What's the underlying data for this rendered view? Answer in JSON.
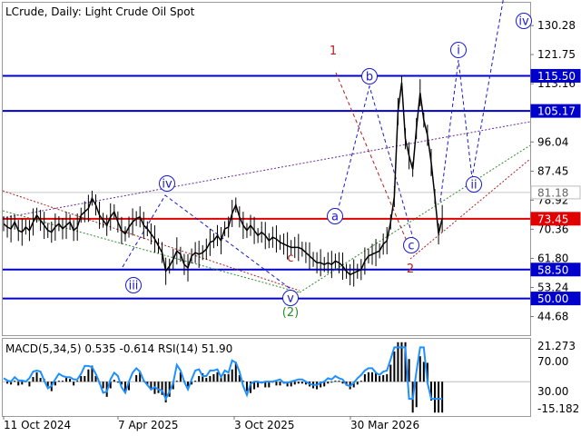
{
  "header": {
    "symbol_line": "LCrude, Daily:  Light Crude Oil Spot"
  },
  "indicator_header": "MACD(5,34,5) 0.535 -0.614 RSI(14) 51.90",
  "colors": {
    "price": "#000000",
    "blue_level": "#0000cc",
    "red_level": "#e00000",
    "grey_level": "#c8c8c8",
    "wave_blue": "#1a1acc",
    "wave_red": "#b02020",
    "wave_green": "#2e8b2e",
    "rsi": "#1e90ff",
    "channel": "#6a2a9a",
    "macd": "#000000"
  },
  "chart_data": {
    "type": "line",
    "title": "LCrude, Daily:  Light Crude Oil Spot",
    "x_tick_labels": [
      "11 Oct 2024",
      "7 Apr 2025",
      "3 Oct 2025",
      "30 Mar 2026"
    ],
    "y_tick_labels": [
      "130.28",
      "121.75",
      "113.16",
      "104.59",
      "96.04",
      "87.45",
      "78.92",
      "70.36",
      "61.80",
      "53.24",
      "44.68"
    ],
    "ylim": [
      39.2,
      137.0
    ],
    "levels": [
      {
        "label": "115.50",
        "value": 115.5,
        "kind": "blue"
      },
      {
        "label": "105.17",
        "value": 105.17,
        "kind": "blue"
      },
      {
        "label": "81.18",
        "value": 81.18,
        "kind": "grey"
      },
      {
        "label": "73.45",
        "value": 73.45,
        "kind": "red"
      },
      {
        "label": "58.50",
        "value": 58.5,
        "kind": "blue"
      },
      {
        "label": "50.00",
        "value": 50.0,
        "kind": "blue"
      }
    ],
    "price_series": {
      "t": [
        0,
        2,
        4,
        6,
        8,
        10,
        12,
        14,
        16,
        18,
        20,
        22,
        24,
        26,
        28,
        30,
        32,
        34,
        36,
        38,
        40,
        42,
        44,
        46,
        48,
        50,
        52,
        54,
        56,
        58,
        60,
        62,
        64,
        66,
        68,
        70,
        72,
        74,
        76,
        78,
        80,
        82,
        84,
        86,
        88,
        90,
        92,
        94,
        96,
        98,
        100,
        102,
        104,
        106,
        108,
        110,
        112,
        114,
        116,
        118,
        120,
        122,
        124,
        126,
        128,
        130,
        132,
        134,
        136,
        138,
        140,
        142,
        144,
        146,
        148,
        150,
        152,
        154,
        156,
        158,
        160,
        162,
        164,
        166,
        168,
        170,
        172,
        174,
        176,
        178,
        180,
        182,
        184,
        186,
        188,
        190,
        192,
        194,
        196,
        198,
        200,
        202,
        204,
        206,
        208,
        210,
        212,
        214,
        216,
        218,
        220,
        222,
        224,
        226,
        228,
        230,
        232,
        234,
        236,
        238
      ],
      "price": [
        72.0,
        71.0,
        70.5,
        72.5,
        70.0,
        69.5,
        71.0,
        70.0,
        72.5,
        74.5,
        73.0,
        71.5,
        70.0,
        69.5,
        71.0,
        72.0,
        70.5,
        71.5,
        72.5,
        70.0,
        71.0,
        74.5,
        75.5,
        76.5,
        79.5,
        77.5,
        74.5,
        73.0,
        71.5,
        74.0,
        75.5,
        72.5,
        70.0,
        69.0,
        71.0,
        72.5,
        73.5,
        74.0,
        71.5,
        70.5,
        69.0,
        67.5,
        65.5,
        63.5,
        58.0,
        59.5,
        61.5,
        64.0,
        63.0,
        60.0,
        59.0,
        62.5,
        63.5,
        63.0,
        63.5,
        64.5,
        66.5,
        67.0,
        68.5,
        67.0,
        70.5,
        71.0,
        75.0,
        77.5,
        74.0,
        71.5,
        70.0,
        71.5,
        70.0,
        68.5,
        69.5,
        68.5,
        67.0,
        68.0,
        67.5,
        66.5,
        66.0,
        65.5,
        65.0,
        65.0,
        65.0,
        64.5,
        63.5,
        62.5,
        61.5,
        60.5,
        60.5,
        60.0,
        60.5,
        60.0,
        61.0,
        60.5,
        59.5,
        58.0,
        57.0,
        57.5,
        58.0,
        58.5,
        61.0,
        62.5,
        63.0,
        63.5,
        64.0,
        66.0,
        67.0,
        72.5,
        80.0,
        105.0,
        113.5,
        97.0,
        92.0,
        88.0,
        100.0,
        110.5,
        102.5,
        98.0,
        90.0,
        80.0,
        69.0,
        73.5,
        84.0,
        78.0
      ]
    },
    "wave_labels": [
      {
        "text": "1",
        "color": "red"
      },
      {
        "text": "2",
        "color": "red"
      },
      {
        "text": "(2)",
        "color": "green"
      },
      {
        "text": "c",
        "color": "red"
      },
      {
        "text": "iii",
        "color": "blue"
      },
      {
        "text": "iv",
        "color": "blue"
      },
      {
        "text": "v",
        "color": "blue"
      },
      {
        "text": "a",
        "color": "blue"
      },
      {
        "text": "b",
        "color": "blue"
      },
      {
        "text": "c",
        "color": "blue"
      },
      {
        "text": "i",
        "color": "blue"
      },
      {
        "text": "ii",
        "color": "blue"
      },
      {
        "text": "iv",
        "color": "blue"
      }
    ],
    "indicator": {
      "name": "MACD(5,34,5) 0.535 -0.614 RSI(14) 51.90",
      "y_tick_labels": [
        "21.273",
        "70.00",
        "30.00",
        "-15.182"
      ]
    }
  }
}
